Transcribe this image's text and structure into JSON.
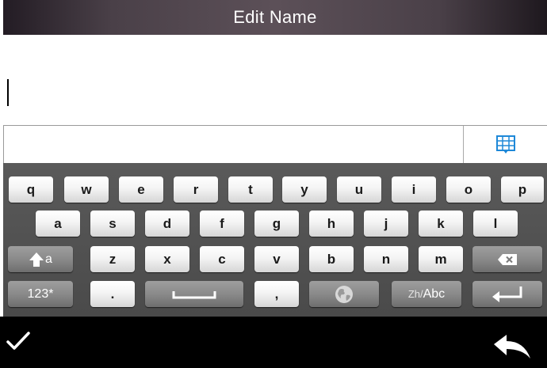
{
  "header": {
    "title": "Edit Name"
  },
  "editor": {
    "value": ""
  },
  "candidate_bar": {
    "grid_icon": "grid-icon",
    "accent_color": "#1e88d8"
  },
  "keyboard": {
    "row1": [
      "q",
      "w",
      "e",
      "r",
      "t",
      "y",
      "u",
      "i",
      "o",
      "p"
    ],
    "row2": [
      "a",
      "s",
      "d",
      "f",
      "g",
      "h",
      "j",
      "k",
      "l"
    ],
    "row3": {
      "shift_sub": "a",
      "letters": [
        "z",
        "x",
        "c",
        "v",
        "b",
        "n",
        "m"
      ],
      "backspace_icon": "backspace-icon"
    },
    "row4": {
      "numbers_label": "123*",
      "period_label": ".",
      "space_icon": "space-icon",
      "comma_label": ",",
      "globe_icon": "globe-icon",
      "lang_prefix": "Zh/",
      "lang_label": "Abc",
      "enter_icon": "enter-icon"
    }
  },
  "bottom_bar": {
    "confirm_icon": "checkmark-icon",
    "back_icon": "back-arrow-icon"
  }
}
